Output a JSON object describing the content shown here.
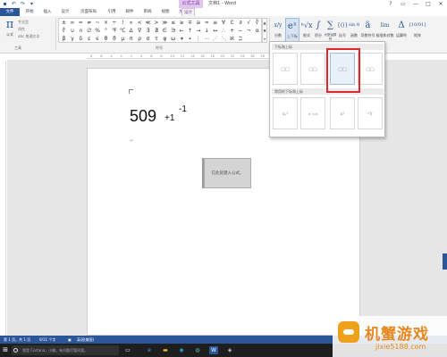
{
  "window": {
    "contextual_tab_title": "公式工具",
    "doc_title": "文档1 - Word",
    "quick_access": [
      "save-icon",
      "undo-icon",
      "redo-icon",
      "customize-icon"
    ],
    "controls": {
      "help": "?",
      "restore": "▭",
      "minimize": "—",
      "maximize": "□",
      "close": "✕"
    }
  },
  "tabs": [
    "文件",
    "开始",
    "插入",
    "设计",
    "页面布局",
    "引用",
    "邮件",
    "审阅",
    "视图",
    "加载项",
    "设计"
  ],
  "ribbon": {
    "tools": {
      "equation_label": "公式",
      "items": [
        "专业型",
        "线性",
        "abc 普通文本"
      ],
      "group_label": "工具"
    },
    "symbols": {
      "grid": [
        "±",
        "∞",
        "=",
        "≠",
        "~",
        "×",
        "÷",
        "!",
        "∝",
        "<",
        "≪",
        ">",
        "≫",
        "≤",
        "≥",
        "∓",
        "≅",
        "≈",
        "≡",
        "∀",
        "∁",
        "∂",
        "√",
        "∛",
        "∜",
        "∪",
        "∩",
        "∅",
        "%",
        "°",
        "℉",
        "℃",
        "∆",
        "∇",
        "∃",
        "∄",
        "∈",
        "∋",
        "←",
        "↑",
        "→",
        "↓",
        "↔",
        "∴",
        "+",
        "−",
        "¬",
        "α",
        "β",
        "γ",
        "δ",
        "ε",
        "ϵ",
        "θ",
        "ϑ",
        "μ",
        "π",
        "ρ",
        "σ",
        "τ",
        "φ",
        "ω",
        "∗",
        "∙",
        "⋮",
        "⋯",
        "⋰",
        "⋱",
        "ℵ",
        "ℶ"
      ],
      "scroll": [
        "▲",
        "▼",
        "▾"
      ],
      "group_label": "符号"
    },
    "structures": [
      {
        "icon": "x/y",
        "label": "分数"
      },
      {
        "icon": "eˣ",
        "label": "上下标"
      },
      {
        "icon": "ⁿ√x",
        "label": "根式"
      },
      {
        "icon": "∫",
        "label": "积分"
      },
      {
        "icon": "∑",
        "label": "大型运算符"
      },
      {
        "icon": "{()}",
        "label": "括号"
      },
      {
        "icon": "sin θ",
        "label": "函数"
      },
      {
        "icon": "ä",
        "label": "导数符号"
      },
      {
        "icon": "lim",
        "label": "极限和对数"
      },
      {
        "icon": "Δ",
        "label": "运算符"
      },
      {
        "icon": "[10/01]",
        "label": "矩阵"
      }
    ],
    "structures_group_label": "结构"
  },
  "gallery": {
    "section1": "下标和上标",
    "section2": "常用的下标和上标",
    "row1": [
      "□□",
      "□□",
      "□□",
      "□□"
    ],
    "row2": [
      "xᵧ²",
      "e⁻ⁱωt",
      "x²",
      "ⁿY"
    ]
  },
  "ruler": {
    "marks": [
      "8",
      "6",
      "4",
      "2",
      "2",
      "4",
      "6",
      "8",
      "10",
      "12",
      "14",
      "16",
      "18",
      "20",
      "22",
      "24",
      "26",
      "28",
      "30",
      "32",
      "34",
      "36",
      "38",
      "40",
      "42",
      "46",
      "48"
    ]
  },
  "document": {
    "equation": {
      "base": "509",
      "subscript": "+1",
      "superscript": "-1"
    },
    "paragraph_mark": "↵",
    "placeholder": "在此处键入公式。"
  },
  "status": {
    "page": "第 1 页，共 1 页",
    "words": "0/11 个字",
    "lang": "英语(美国)"
  },
  "taskbar": {
    "cortana_text": "我是 Cortana，小娜。有问题尽管问我。"
  },
  "brand": {
    "name": "机蟹游戏",
    "url": "jixie5188.com"
  },
  "colors": {
    "accent": "#2b579a",
    "contextual": "#7a2f9a",
    "highlight": "#e0262a",
    "brand": "#e8871e"
  }
}
